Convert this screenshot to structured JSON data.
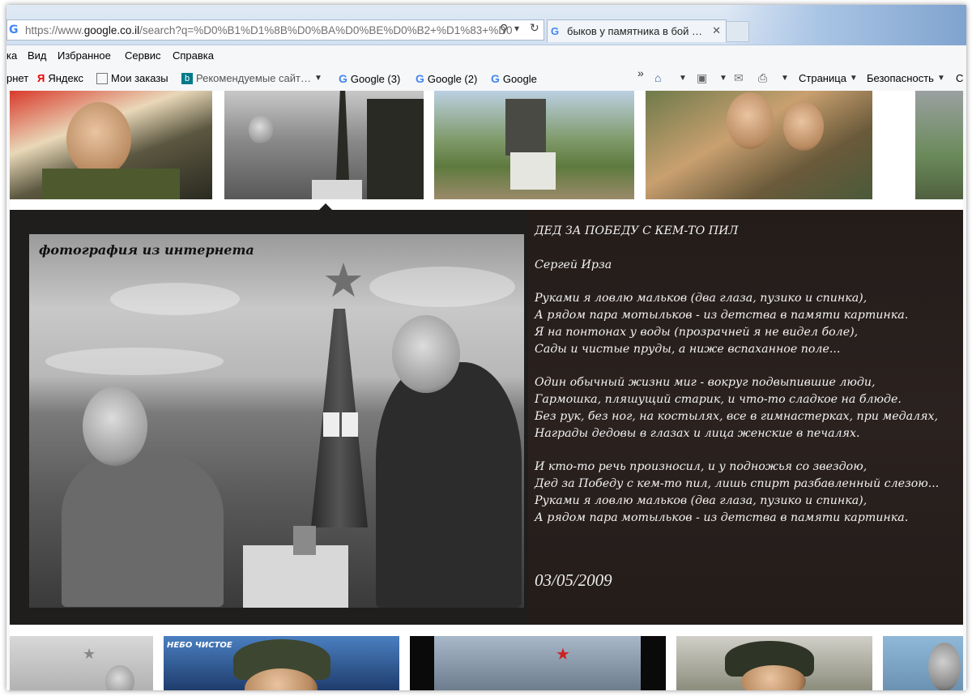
{
  "browser": {
    "address_url_prefix": "https://www.",
    "address_url_domain": "google.co.il",
    "address_url_rest": "/search?q=%D0%B1%D1%8B%D0%BA%D0%BE%D0%B2+%D1%83+%D0",
    "tab_title": "быков у памятника в бой …",
    "tab_close": "✕",
    "search_glyph": "⚲",
    "dropdown_glyph": "▾",
    "refresh_glyph": "↻",
    "google_glyph": "G"
  },
  "menu": {
    "items": [
      "ка",
      "Вид",
      "Избранное",
      "Сервис",
      "Справка"
    ]
  },
  "favorites": {
    "internet": "рнет",
    "yandex": "Яндекс",
    "orders": "Мои заказы",
    "recommended": "Рекомендуемые сайт…",
    "google3": "Google (3)",
    "google2": "Google (2)",
    "google": "Google",
    "chevron": "»",
    "page_menu": "Страница",
    "security_menu": "Безопасность",
    "cut": "С"
  },
  "preview": {
    "caption": "фотография из интернета",
    "poem": {
      "title": "ДЕД ЗА ПОБЕДУ С КЕМ-ТО ПИЛ",
      "author": "Сергей Ирза",
      "stanza1": [
        "Руками я ловлю мальков (два глаза, пузико и спинка),",
        "А рядом пара мотыльков - из детства в памяти картинка.",
        "Я на понтонах у воды (прозрачней я не видел боле),",
        "Сады и чистые пруды, а ниже вспаханное поле..."
      ],
      "stanza2": [
        "Один обычный жизни миг - вокруг подвыпившие люди,",
        "Гармошка, пляшущий старик, и что-то сладкое на блюде.",
        "Без рук, без ног, на костылях, все в гимнастерках, при медалях,",
        "Награды дедовы в глазах и лица женские в печалях."
      ],
      "stanza3": [
        "И кто-то речь произносил, и у подножья со звездою,",
        "Дед за Победу с кем-то пил, лишь спирт разбавленный слезою...",
        "Руками я ловлю мальков (два глаза, пузико и спинка),",
        "А рядом пара мотыльков - из детства в памяти картинка."
      ]
    },
    "date": "03/05/2009"
  },
  "bottom": {
    "thumb2_caption": "НЕБО ЧИСТОЕ"
  }
}
